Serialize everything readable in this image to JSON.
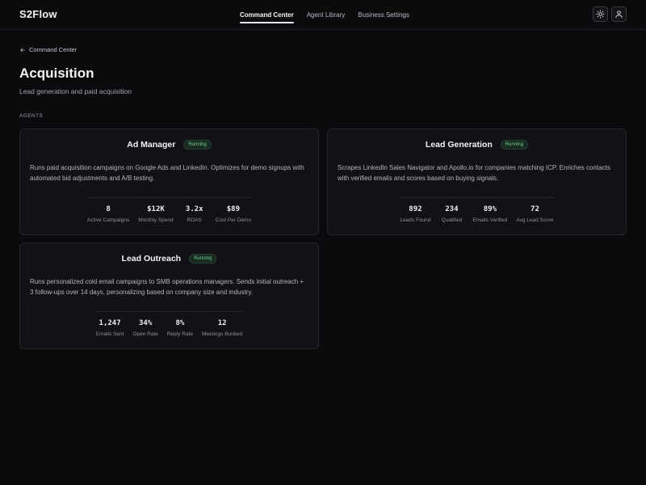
{
  "app": {
    "logo": "S2Flow"
  },
  "nav": {
    "tabs": [
      {
        "label": "Command Center",
        "active": true
      },
      {
        "label": "Agent Library",
        "active": false
      },
      {
        "label": "Business Settings",
        "active": false
      }
    ],
    "icons": [
      "sun-icon",
      "user-icon"
    ]
  },
  "header": {
    "back_label": "Command Center",
    "title": "Acquisition",
    "subtitle": "Lead generation and paid acquisition",
    "section_label": "AGENTS"
  },
  "colors": {
    "background": "#0b0a0d",
    "card": "#121116",
    "status_running": "#6fcf97"
  },
  "agents": [
    {
      "name": "Ad Manager",
      "status": "Running",
      "description": "Runs paid acquisition campaigns on Google Ads and LinkedIn. Optimizes for demo signups with automated bid adjustments and A/B testing.",
      "stats": [
        {
          "value": "8",
          "label": "Active Campaigns"
        },
        {
          "value": "$12K",
          "label": "Monthly Spend"
        },
        {
          "value": "3.2x",
          "label": "ROAS"
        },
        {
          "value": "$89",
          "label": "Cost Per Demo"
        }
      ]
    },
    {
      "name": "Lead Generation",
      "status": "Running",
      "description": "Scrapes LinkedIn Sales Navigator and Apollo.io for companies matching ICP. Enriches contacts with verified emails and scores based on buying signals.",
      "stats": [
        {
          "value": "892",
          "label": "Leads Found"
        },
        {
          "value": "234",
          "label": "Qualified"
        },
        {
          "value": "89%",
          "label": "Emails Verified"
        },
        {
          "value": "72",
          "label": "Avg Lead Score"
        }
      ]
    },
    {
      "name": "Lead Outreach",
      "status": "Running",
      "description": "Runs personalized cold email campaigns to SMB operations managers. Sends initial outreach + 3 follow-ups over 14 days, personalizing based on company size and industry.",
      "stats": [
        {
          "value": "1,247",
          "label": "Emails Sent"
        },
        {
          "value": "34%",
          "label": "Open Rate"
        },
        {
          "value": "8%",
          "label": "Reply Rate"
        },
        {
          "value": "12",
          "label": "Meetings Booked"
        }
      ]
    }
  ]
}
